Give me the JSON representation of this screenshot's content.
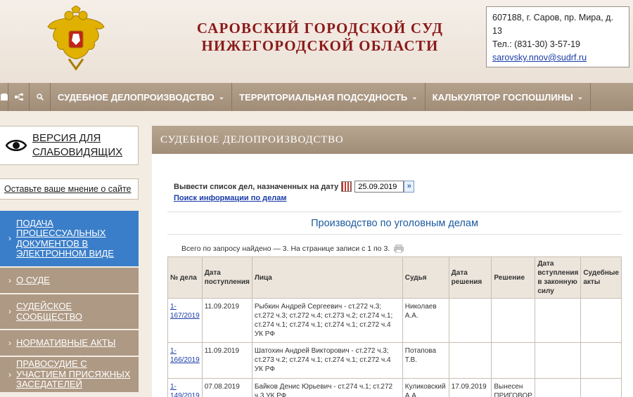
{
  "header": {
    "court_name_line1": "САРОВСКИЙ ГОРОДСКОЙ СУД",
    "court_name_line2": "НИЖЕГОРОДСКОЙ ОБЛАСТИ",
    "address": "607188, г. Саров, пр. Мира, д. 13",
    "phone": "Тел.: (831-30) 3-57-19",
    "email": "sarovsky.nnov@sudrf.ru"
  },
  "navbar": {
    "items": [
      {
        "label": "СУДЕБНОЕ ДЕЛОПРОИЗВОДСТВО",
        "chevron": "⌄"
      },
      {
        "label": "ТЕРРИТОРИАЛЬНАЯ ПОДСУДНОСТЬ",
        "chevron": "⌄"
      },
      {
        "label": "КАЛЬКУЛЯТОР ГОСПОШЛИНЫ",
        "chevron": "⌄"
      }
    ],
    "icons": [
      "home-icon",
      "sitemap-icon",
      "search-icon"
    ]
  },
  "sidebar": {
    "vision_label_line1": "ВЕРСИЯ ДЛЯ",
    "vision_label_line2": "СЛАБОВИДЯЩИХ",
    "feedback_label": "Оставьте ваше мнение о сайте",
    "menu": [
      {
        "label": "Подача процессуальных документов в электронном виде",
        "active": true
      },
      {
        "label": "О суде",
        "active": false
      },
      {
        "label": "Судейское сообщество",
        "active": false
      },
      {
        "label": "Нормативные акты",
        "active": false
      },
      {
        "label": "Правосудие с участием присяжных заседателей",
        "active": false
      }
    ]
  },
  "main": {
    "panel_title": "СУДЕБНОЕ ДЕЛОПРОИЗВОДСТВО",
    "date_label": "Вывести список дел, назначенных на дату",
    "date_value": "25.09.2019",
    "search_link": "Поиск информации по делам",
    "section_title": "Производство по уголовным делам",
    "found_text": "Всего по запросу найдено — 3. На странице записи с 1 по 3.",
    "table": {
      "headers": [
        "№ дела",
        "Дата поступления",
        "Лица",
        "Судья",
        "Дата решения",
        "Решение",
        "Дата вступления в законную силу",
        "Судебные акты"
      ],
      "rows": [
        {
          "case": "1-167/2019",
          "date_in": "11.09.2019",
          "persons": "Рыбкин Андрей Сергеевич - ст.272 ч.3; ст.272 ч.3; ст.272 ч.4; ст.273 ч.2; ст.274 ч.1; ст.274 ч.1; ст.274 ч.1; ст.274 ч.1; ст.272 ч.4 УК РФ",
          "judge": "Николаев А.А.",
          "date_decision": "",
          "decision": "",
          "date_effective": "",
          "acts": ""
        },
        {
          "case": "1-166/2019",
          "date_in": "11.09.2019",
          "persons": "Шатохин Андрей Викторович - ст.272 ч.3; ст.273 ч.2; ст.274 ч.1; ст.274 ч.1; ст.272 ч.4 УК РФ",
          "judge": "Потапова Т.В.",
          "date_decision": "",
          "decision": "",
          "date_effective": "",
          "acts": ""
        },
        {
          "case": "1-149/2019",
          "date_in": "07.08.2019",
          "persons": "Байков Денис Юрьевич - ст.274 ч.1; ст.272 ч.3 УК РФ",
          "judge": "Куликовский А.А.",
          "date_decision": "17.09.2019",
          "decision": "Вынесен ПРИГОВОР",
          "date_effective": "",
          "acts": ""
        }
      ]
    }
  },
  "colors": {
    "court_name": "#8b1a1a",
    "nav_bg": "#a8947f",
    "active_menu": "#3a7ec9",
    "link": "#1a3ca8",
    "section_title": "#1d5a9e"
  }
}
